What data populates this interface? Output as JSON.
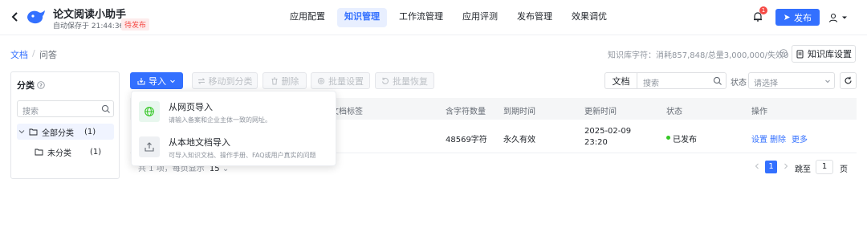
{
  "header": {
    "app_title": "论文阅读小助手",
    "save_status": "自动保存于 21:44:36",
    "pending_badge": "待发布",
    "nav_tabs": [
      {
        "label": "应用配置"
      },
      {
        "label": "知识管理"
      },
      {
        "label": "工作流管理"
      },
      {
        "label": "应用评测"
      },
      {
        "label": "发布管理"
      },
      {
        "label": "效果调优"
      }
    ],
    "active_tab": "知识管理",
    "notification_count": "1",
    "publish_label": "发布"
  },
  "breadcrumb": {
    "root": "文档",
    "separator": "/",
    "current": "问答"
  },
  "kb": {
    "usage_text": "知识库字符：消耗857,848/总量3,000,000/失效0",
    "settings_label": "知识库设置"
  },
  "sidebar": {
    "title": "分类",
    "search_placeholder": "搜索",
    "tree": [
      {
        "label": "全部分类",
        "count": "(1)"
      },
      {
        "label": "未分类",
        "count": "(1)"
      }
    ]
  },
  "toolbar": {
    "import_label": "导入",
    "move_label": "移动到分类",
    "delete_label": "删除",
    "batch_settings_label": "批量设置",
    "batch_restore_label": "批量恢复"
  },
  "filters": {
    "type_value": "文档",
    "search_placeholder": "搜索",
    "status_label": "状态",
    "status_placeholder": "请选择"
  },
  "table": {
    "headers": [
      "文档标签",
      "含字符数量",
      "到期时间",
      "更新时间",
      "状态",
      "操作"
    ],
    "rows": [
      {
        "chars": "48569字符",
        "expiry": "永久有效",
        "updated_date": "2025-02-09",
        "updated_time": "23:20",
        "status": "已发布",
        "actions": [
          "设置",
          "删除",
          "更多"
        ]
      }
    ]
  },
  "pagination": {
    "summary": "共 1 项，每页显示",
    "page_size": "15",
    "current_page": "1",
    "goto_label": "跳至",
    "goto_value": "1",
    "page_suffix": "页"
  },
  "import_menu": {
    "items": [
      {
        "title": "从网页导入",
        "desc": "请输入备案和企业主体一致的网址。",
        "icon": "globe-icon"
      },
      {
        "title": "从本地文档导入",
        "desc": "可导入知识文档、操作手册、FAQ或用户真实的问题",
        "icon": "upload-icon"
      }
    ]
  },
  "colors": {
    "primary": "#3370ff",
    "published_dot": "#34c724",
    "badge_red": "#f54a45"
  }
}
